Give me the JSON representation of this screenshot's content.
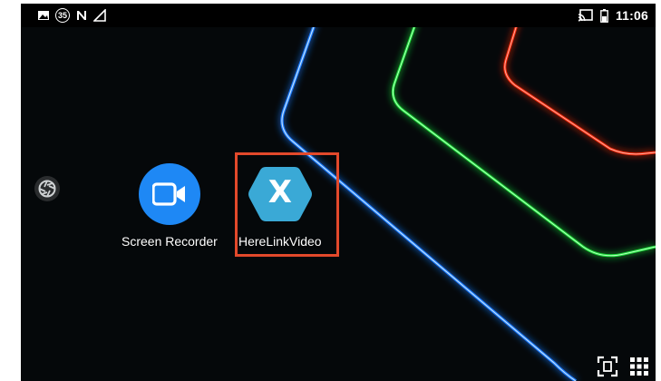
{
  "status_bar": {
    "left_icons": [
      "image-icon",
      "notification-35-icon",
      "nfc-icon",
      "signal-icon"
    ],
    "badge_text": "35",
    "right_icons": [
      "cast-icon",
      "battery-icon"
    ],
    "time": "11:06"
  },
  "home": {
    "apps": [
      {
        "label": "Screen Recorder",
        "icon": "video-camera-icon",
        "color": "#1e88f5"
      },
      {
        "label": "HereLinkVideo",
        "icon": "xamarin-x-icon",
        "color": "#3aa9d6",
        "highlighted": true
      }
    ],
    "hexagon_letter": "X"
  },
  "colors": {
    "highlight_border": "#e3492b",
    "neon_blue": "#1a7bff",
    "neon_green": "#1fe03a",
    "neon_red": "#ff2a10"
  },
  "side_controls": {
    "shutter": "camera-shutter-icon"
  },
  "nav_controls": [
    "screenshot-icon",
    "apps-grid-icon"
  ]
}
